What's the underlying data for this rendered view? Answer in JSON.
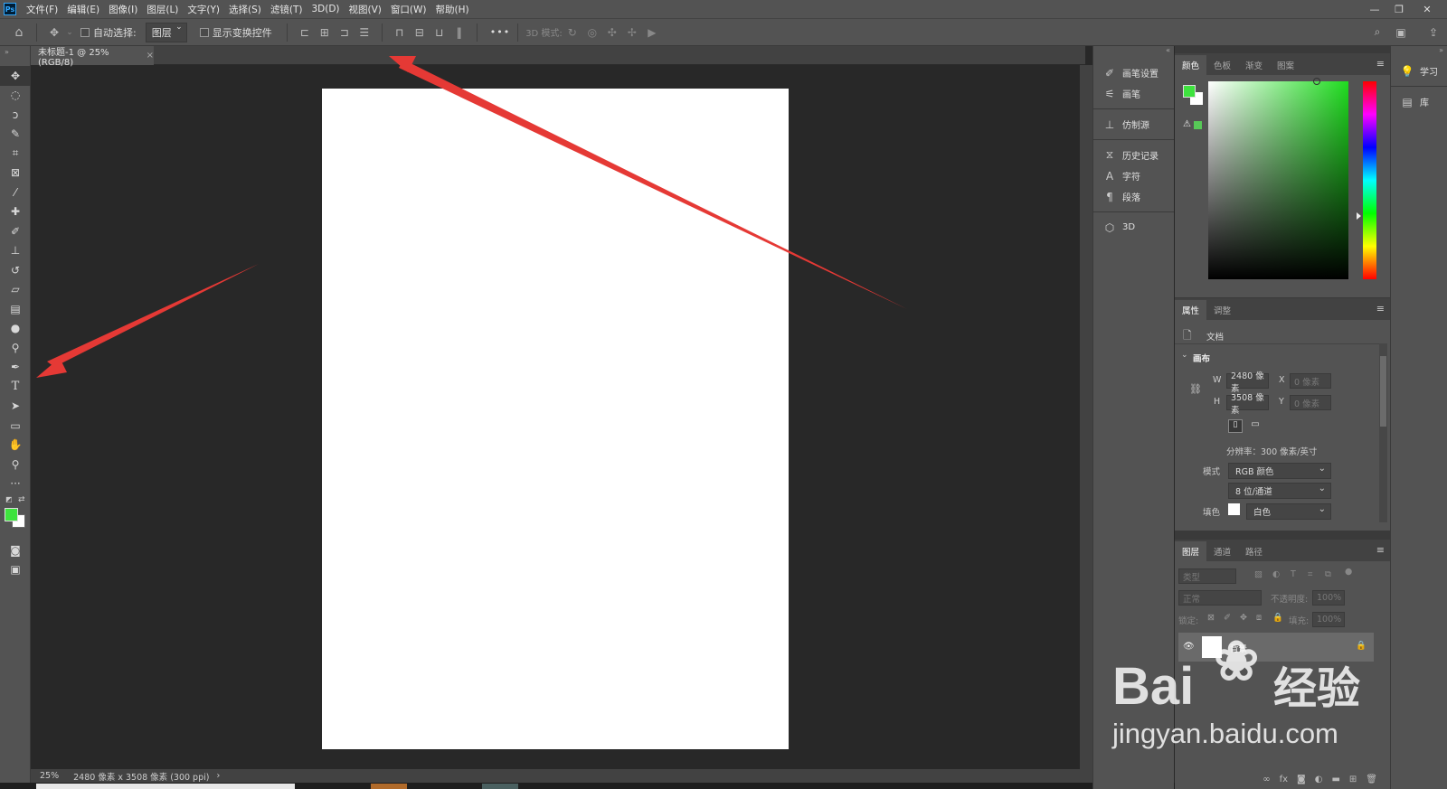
{
  "menubar": {
    "logo": "Ps",
    "items": [
      "文件(F)",
      "编辑(E)",
      "图像(I)",
      "图层(L)",
      "文字(Y)",
      "选择(S)",
      "滤镜(T)",
      "3D(D)",
      "视图(V)",
      "窗口(W)",
      "帮助(H)"
    ],
    "window_controls": [
      "—",
      "❐",
      "✕"
    ]
  },
  "options": {
    "auto_select_label": "自动选择:",
    "auto_select_value": "图层",
    "show_transform_label": "显示变换控件",
    "more": "•••",
    "mode_3d_label": "3D 模式:"
  },
  "document": {
    "tab_title": "未标题-1 @ 25%(RGB/8)",
    "tab_close": "×",
    "zoom": "25%",
    "status_info": "2480 像素 x 3508 像素 (300 ppi)",
    "status_arrow": "›"
  },
  "dock_panels": {
    "items": [
      "画笔设置",
      "画笔",
      "仿制源",
      "历史记录",
      "字符",
      "段落",
      "3D"
    ]
  },
  "color_panel": {
    "tabs": [
      "颜色",
      "色板",
      "渐变",
      "图案"
    ],
    "foreground": "#3ee33e",
    "background": "#ffffff",
    "gamut_warning": "⚠"
  },
  "properties": {
    "tabs": [
      "属性",
      "调整"
    ],
    "doc_label": "文档",
    "section": "画布",
    "w_label": "W",
    "w_value": "2480 像素",
    "h_label": "H",
    "h_value": "3508 像素",
    "x_label": "X",
    "x_value": "0 像素",
    "y_label": "Y",
    "y_value": "0 像素",
    "resolution": "分辨率：300 像素/英寸",
    "mode_label": "模式",
    "mode_value": "RGB 颜色",
    "bit_value": "8 位/通道",
    "fill_label": "填色",
    "fill_value": "白色"
  },
  "layers": {
    "tabs": [
      "图层",
      "通道",
      "路径"
    ],
    "search_placeholder": "类型",
    "blend": "正常",
    "opacity_label": "不透明度:",
    "opacity_value": "100%",
    "lock_label": "锁定:",
    "fill_label": "填充:",
    "fill_value": "100%",
    "layer_name": "背景"
  },
  "right_dock": {
    "learn": "学习",
    "library": "库"
  },
  "watermark": {
    "brand": "Bai",
    "brand_cn": "经验",
    "url": "jingyan.baidu.com"
  },
  "annotation_color": "#e53935"
}
